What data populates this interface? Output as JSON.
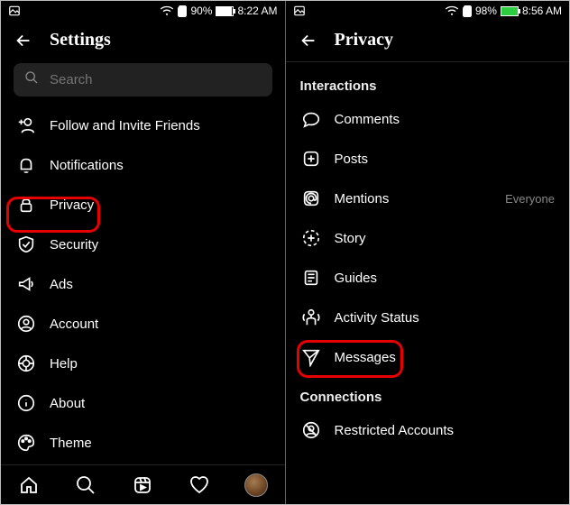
{
  "left": {
    "statusbar": {
      "battery_pct": "90%",
      "time": "8:22 AM"
    },
    "header": {
      "title": "Settings"
    },
    "search": {
      "placeholder": "Search"
    },
    "items": [
      {
        "label": "Follow and Invite Friends"
      },
      {
        "label": "Notifications"
      },
      {
        "label": "Privacy"
      },
      {
        "label": "Security"
      },
      {
        "label": "Ads"
      },
      {
        "label": "Account"
      },
      {
        "label": "Help"
      },
      {
        "label": "About"
      },
      {
        "label": "Theme"
      }
    ]
  },
  "right": {
    "statusbar": {
      "battery_pct": "98%",
      "time": "8:56 AM"
    },
    "header": {
      "title": "Privacy"
    },
    "sections": {
      "interactions": "Interactions",
      "connections": "Connections"
    },
    "items": [
      {
        "label": "Comments"
      },
      {
        "label": "Posts"
      },
      {
        "label": "Mentions",
        "value": "Everyone"
      },
      {
        "label": "Story"
      },
      {
        "label": "Guides"
      },
      {
        "label": "Activity Status"
      },
      {
        "label": "Messages"
      },
      {
        "label": "Restricted Accounts"
      }
    ]
  }
}
